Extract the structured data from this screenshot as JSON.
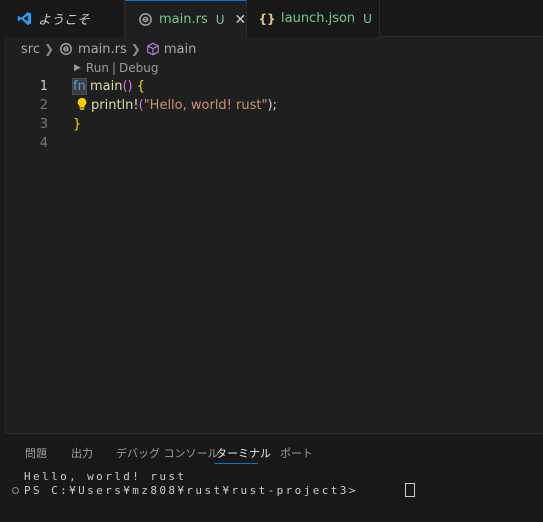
{
  "tabs": [
    {
      "label": "ようこそ",
      "icon": "vscode-logo-icon"
    },
    {
      "label": "main.rs",
      "status": "U",
      "icon": "rust-icon",
      "active": true
    },
    {
      "label": "launch.json",
      "status": "U",
      "icon": "json-braces-icon"
    }
  ],
  "breadcrumb": {
    "folder": "src",
    "file": "main.rs",
    "symbol": "main"
  },
  "codelens": {
    "run": "Run",
    "divider": "|",
    "debug": "Debug"
  },
  "editor": {
    "line_numbers": [
      "1",
      "2",
      "3",
      "4"
    ],
    "line1": {
      "kw": "fn",
      "name": "main",
      "parens": "()",
      "open": "{"
    },
    "line2": {
      "macro": "println!",
      "open_paren": "(",
      "string": "\"Hello, world! rust\"",
      "close": ");"
    },
    "line3": {
      "close": "}"
    }
  },
  "panel": {
    "tabs": [
      "問題",
      "出力",
      "デバッグ コンソール",
      "ターミナル",
      "ポート"
    ],
    "active_tab": "ターミナル"
  },
  "terminal": {
    "output": "Hello, world! rust",
    "prompt": "PS C:¥Users¥mz808¥rust¥rust-project3>"
  },
  "colors": {
    "accent": "#0078d4",
    "untracked": "#73c991",
    "keyword": "#569cd6",
    "function": "#dcdcaa",
    "string": "#ce9178"
  }
}
